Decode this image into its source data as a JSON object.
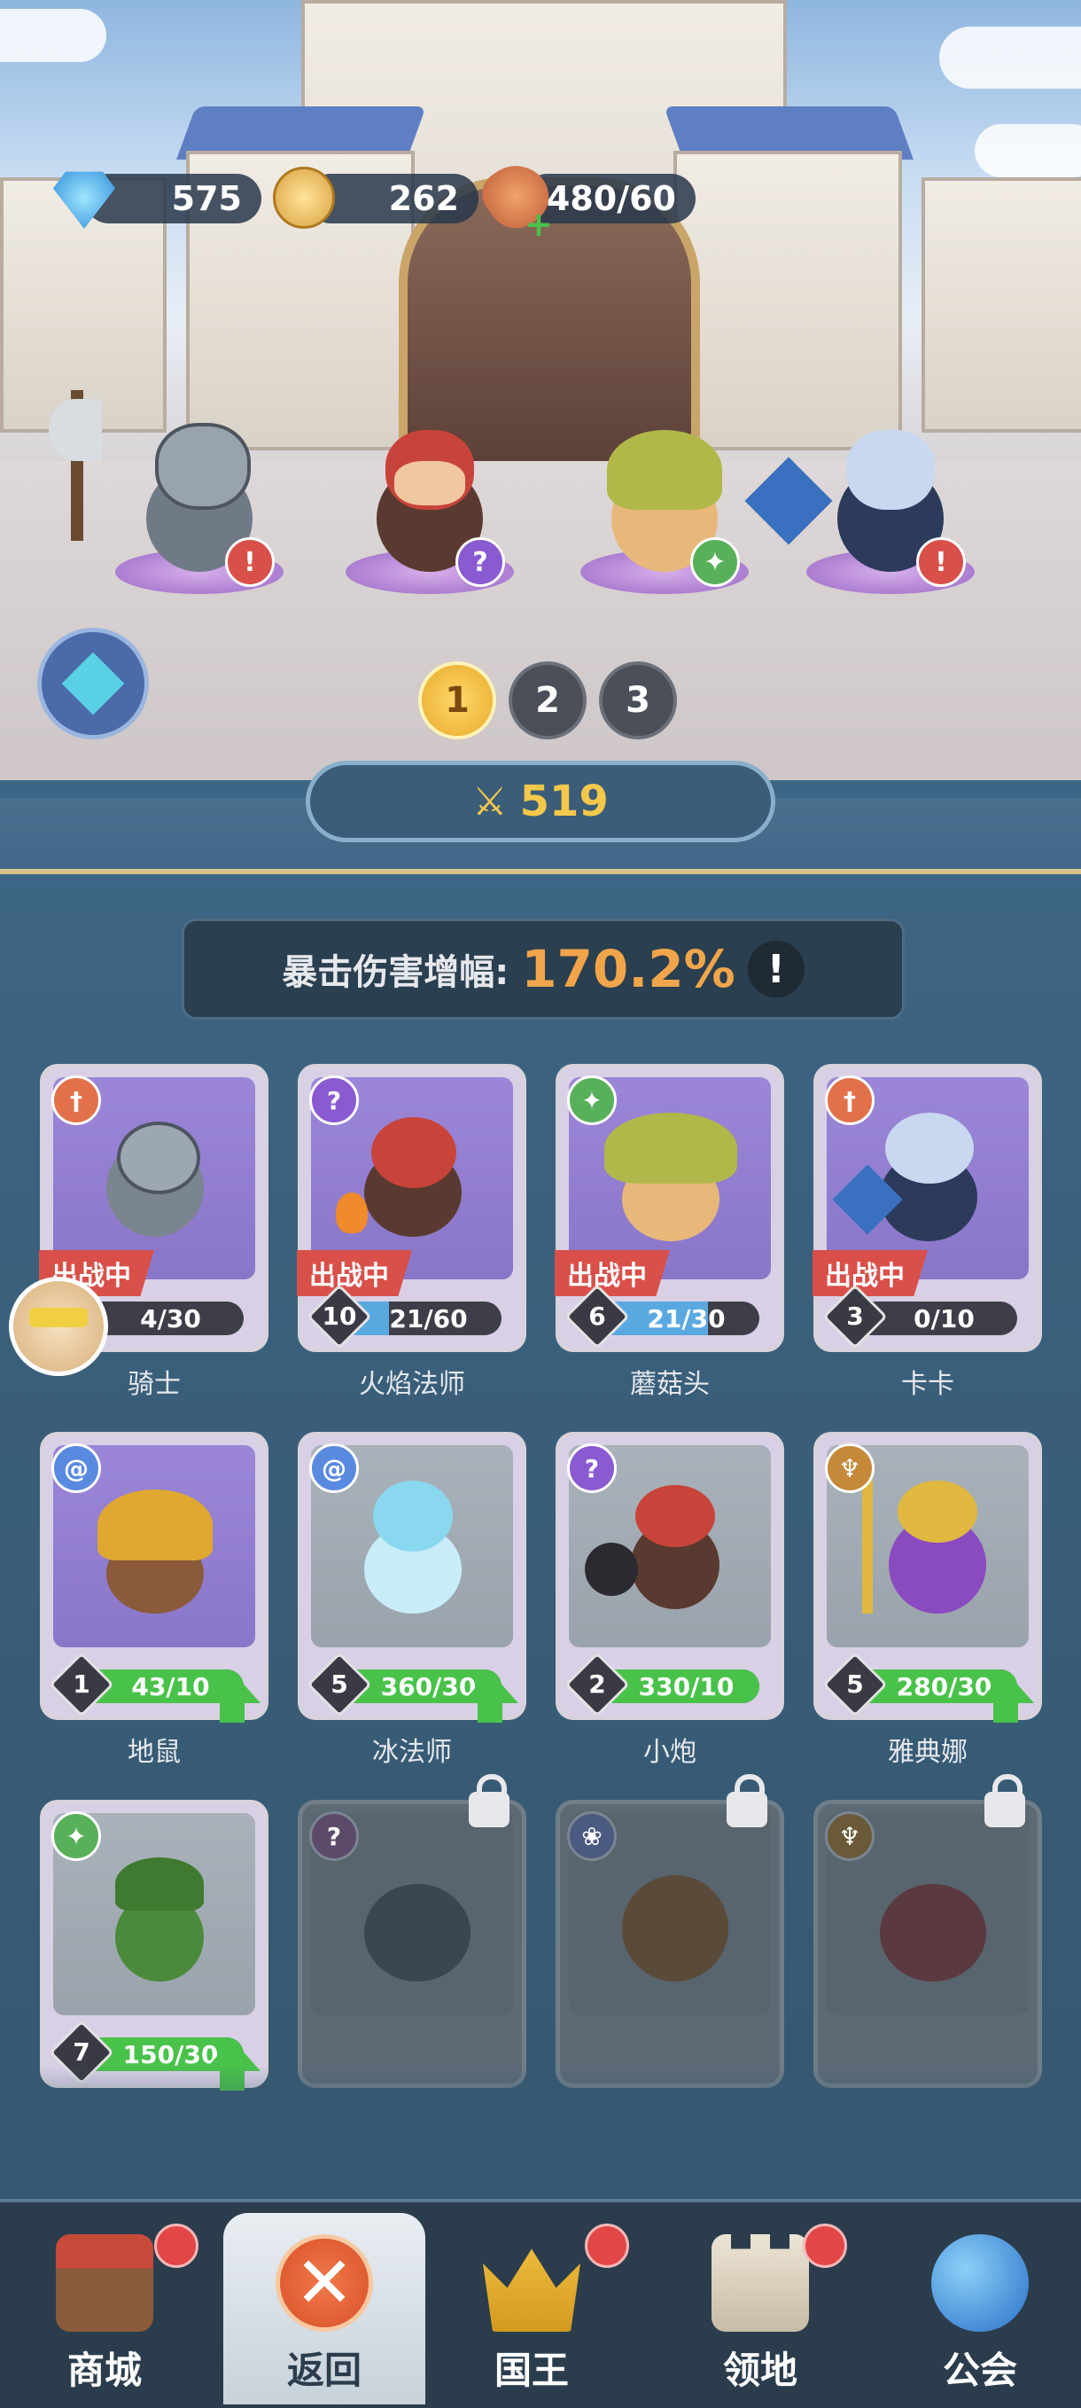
{
  "resources": {
    "gems": "575",
    "coins": "262",
    "stamina": "480/60"
  },
  "team_pages": [
    "1",
    "2",
    "3"
  ],
  "power": "519",
  "crit": {
    "label": "暴击伤害增幅:",
    "value": "170.2%",
    "info": "!"
  },
  "deployed_label": "出战中",
  "heroes": [
    {
      "name": "骑士",
      "level": "",
      "progress": "4/30",
      "progress_fraction": 0.13,
      "deployed": true,
      "type_icon": "sword-icon",
      "type_color": "#e2714a",
      "upgrade": false
    },
    {
      "name": "火焰法师",
      "level": "10",
      "progress": "21/60",
      "progress_fraction": 0.35,
      "deployed": true,
      "type_icon": "staff-icon",
      "type_color": "#8a5ad0",
      "upgrade": false
    },
    {
      "name": "蘑菇头",
      "level": "6",
      "progress": "21/30",
      "progress_fraction": 0.7,
      "deployed": true,
      "type_icon": "constellation-icon",
      "type_color": "#58b05a",
      "upgrade": false
    },
    {
      "name": "卡卡",
      "level": "3",
      "progress": "0/10",
      "progress_fraction": 0.0,
      "deployed": true,
      "type_icon": "sword-icon",
      "type_color": "#e2714a",
      "upgrade": false
    },
    {
      "name": "地鼠",
      "level": "1",
      "progress": "43/10",
      "progress_fraction": 1.0,
      "deployed": false,
      "type_icon": "swirl-icon",
      "type_color": "#5a8ae0",
      "upgrade": true
    },
    {
      "name": "冰法师",
      "level": "5",
      "progress": "360/30",
      "progress_fraction": 1.0,
      "deployed": false,
      "type_icon": "swirl-icon",
      "type_color": "#5a8ae0",
      "upgrade": true
    },
    {
      "name": "小炮",
      "level": "2",
      "progress": "330/10",
      "progress_fraction": 1.0,
      "deployed": false,
      "type_icon": "staff-icon",
      "type_color": "#8a5ad0",
      "upgrade": true
    },
    {
      "name": "雅典娜",
      "level": "5",
      "progress": "280/30",
      "progress_fraction": 1.0,
      "deployed": false,
      "type_icon": "wings-icon",
      "type_color": "#c48a3a",
      "upgrade": true
    },
    {
      "name": "",
      "level": "7",
      "progress": "150/30",
      "progress_fraction": 1.0,
      "deployed": false,
      "type_icon": "constellation-icon",
      "type_color": "#58b05a",
      "upgrade": true
    }
  ],
  "nav": [
    {
      "label": "商城",
      "badge": true
    },
    {
      "label": "返回",
      "badge": false
    },
    {
      "label": "国王",
      "badge": true
    },
    {
      "label": "领地",
      "badge": true
    },
    {
      "label": "公会",
      "badge": false
    }
  ],
  "colors": {
    "panel": "#3a5f7b",
    "crit_value": "#f1a54a",
    "progress_fill_full": "#49c24a",
    "progress_fill_partial": "#5aa8e0",
    "deploy_tag": "#d9504a",
    "notification": "#e24646"
  }
}
